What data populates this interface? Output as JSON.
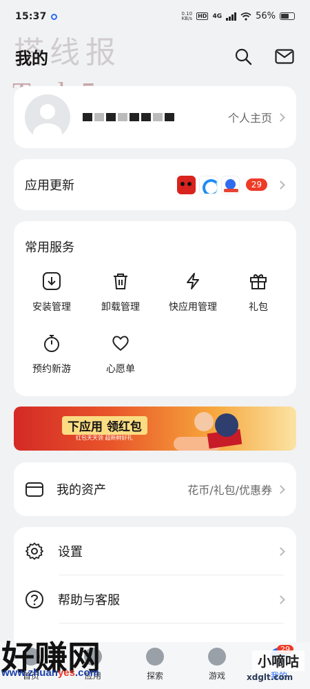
{
  "status_bar": {
    "time": "15:37",
    "net_speed_value": "0.10",
    "net_speed_unit": "KB/s",
    "hd": "HD",
    "network": "4G",
    "battery": "56%"
  },
  "header": {
    "title": "我的"
  },
  "watermarks": {
    "top_text": "搭线报",
    "brand": "Taolu5.com",
    "bottom_left": "好赚网",
    "bottom_left_url_a": "www.zhuan",
    "bottom_left_url_b": "yes",
    "bottom_left_url_c": ".com",
    "bottom_right": "小嘀咕",
    "bottom_right_url": "xdglt.com"
  },
  "profile": {
    "link_label": "个人主页"
  },
  "app_updates": {
    "label": "应用更新",
    "count": "29",
    "apps": [
      "tmall-icon",
      "browser-icon",
      "baidu-icon"
    ]
  },
  "services": {
    "label": "常用服务",
    "items": [
      {
        "label": "安装管理",
        "icon": "download-icon"
      },
      {
        "label": "卸载管理",
        "icon": "trash-icon"
      },
      {
        "label": "快应用管理",
        "icon": "lightning-icon"
      },
      {
        "label": "礼包",
        "icon": "gift-icon"
      },
      {
        "label": "预约新游",
        "icon": "stopwatch-icon"
      },
      {
        "label": "心愿单",
        "icon": "heart-icon"
      }
    ]
  },
  "banner": {
    "title": "下应用 领红包",
    "subtitle": "红包天天领 超新鲜好礼"
  },
  "assets": {
    "label": "我的资产",
    "link_label": "花币/礼包/优惠券"
  },
  "settings": {
    "items": [
      {
        "label": "设置",
        "icon": "gear-icon"
      },
      {
        "label": "帮助与客服",
        "icon": "help-icon"
      }
    ]
  },
  "bottom_nav": {
    "items": [
      {
        "label": "首页"
      },
      {
        "label": "应用"
      },
      {
        "label": "探索"
      },
      {
        "label": "游戏"
      },
      {
        "label": "我的"
      }
    ],
    "badge": "29"
  }
}
